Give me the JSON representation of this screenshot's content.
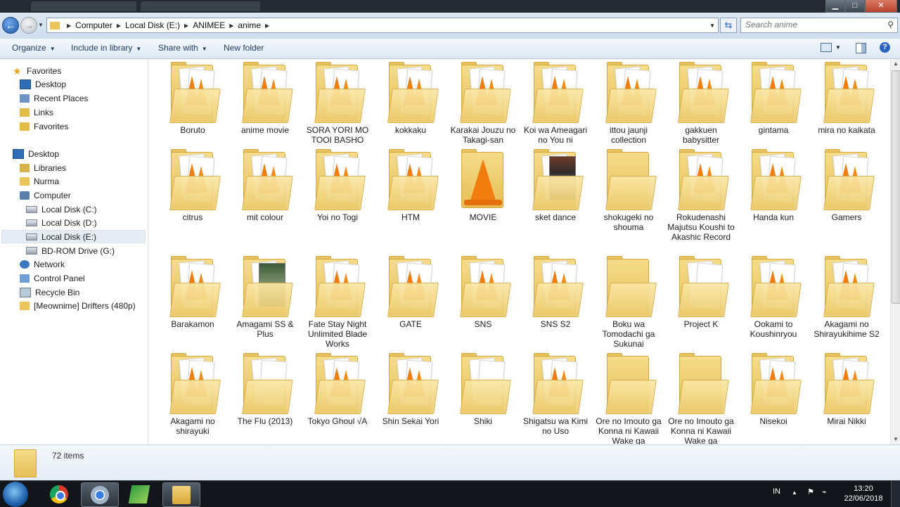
{
  "window": {
    "minimize": "▁",
    "maximize": "□",
    "close": "✕"
  },
  "address": {
    "crumbs": [
      "Computer",
      "Local Disk (E:)",
      "ANIMEE",
      "anime"
    ],
    "search_placeholder": "Search anime"
  },
  "toolbar": {
    "organize": "Organize",
    "include": "Include in library",
    "share": "Share with",
    "new_folder": "New folder"
  },
  "nav": {
    "favorites": "Favorites",
    "desktop_fav": "Desktop",
    "recent": "Recent Places",
    "links": "Links",
    "favorites_sub": "Favorites",
    "desktop": "Desktop",
    "libraries": "Libraries",
    "user": "Nurma",
    "computer": "Computer",
    "disk_c": "Local Disk (C:)",
    "disk_d": "Local Disk (D:)",
    "disk_e": "Local Disk (E:)",
    "bd": "BD-ROM Drive (G:)",
    "network": "Network",
    "control_panel": "Control Panel",
    "recycle": "Recycle Bin",
    "drifters": "[Meownime] Drifters (480p)"
  },
  "folders": [
    "Boruto",
    "anime movie",
    "SORA YORI MO TOOI BASHO",
    "kokkaku",
    "Karakai Jouzu no Takagi-san",
    "Koi wa Ameagari no You ni",
    "ittou jaunji collection",
    "gakkuen babysitter",
    "gintama",
    "mira no kaikata",
    "citrus",
    "mit colour",
    "Yoi no Togi",
    "HTM",
    "MOVIE",
    "sket dance",
    "shokugeki no shouma",
    "Rokudenashi Majutsu Koushi to Akashic Record",
    "Handa kun",
    "Gamers",
    "Barakamon",
    "Amagami SS & Plus",
    "Fate Stay Night Unlimited Blade Works",
    "GATE",
    "SNS",
    "SNS S2",
    "Boku wa Tomodachi ga Sukunai",
    "Project K",
    "Ookami to Koushinryou",
    "Akagami no Shirayukihime S2",
    "Akagami no shirayuki",
    "The Flu (2013)",
    "Tokyo Ghoul √A",
    "Shin Sekai Yori",
    "Shiki",
    "Shigatsu wa Kimi no Uso",
    "Ore no Imouto ga Konna ni Kawaii Wake ga",
    "Ore no Imouto ga Konna ni Kawaii Wake ga",
    "Nisekoi",
    "Mirai Nikki"
  ],
  "folder_styles": [
    "vlc",
    "vlc",
    "vlc",
    "vlc",
    "vlc",
    "vlc",
    "vlc",
    "vlc",
    "vlc",
    "vlc",
    "vlc",
    "vlc",
    "vlc",
    "vlc",
    "vlcbig",
    "photo",
    "plain",
    "vlc",
    "vlc",
    "vlc",
    "vlc",
    "photo2",
    "vlc",
    "vlc",
    "vlc",
    "vlc",
    "plain",
    "paper",
    "vlc",
    "vlc",
    "vlc",
    "paper",
    "vlc",
    "vlc",
    "paper",
    "vlc",
    "plain",
    "plain",
    "vlc",
    "vlc"
  ],
  "status": {
    "item_count": "72 items"
  },
  "taskbar": {
    "lang": "IN",
    "time": "13:20",
    "date": "22/06/2018"
  },
  "colors": {
    "folder": "#e8c45a",
    "vlc": "#f07d0e",
    "accent": "#2b63c2"
  }
}
